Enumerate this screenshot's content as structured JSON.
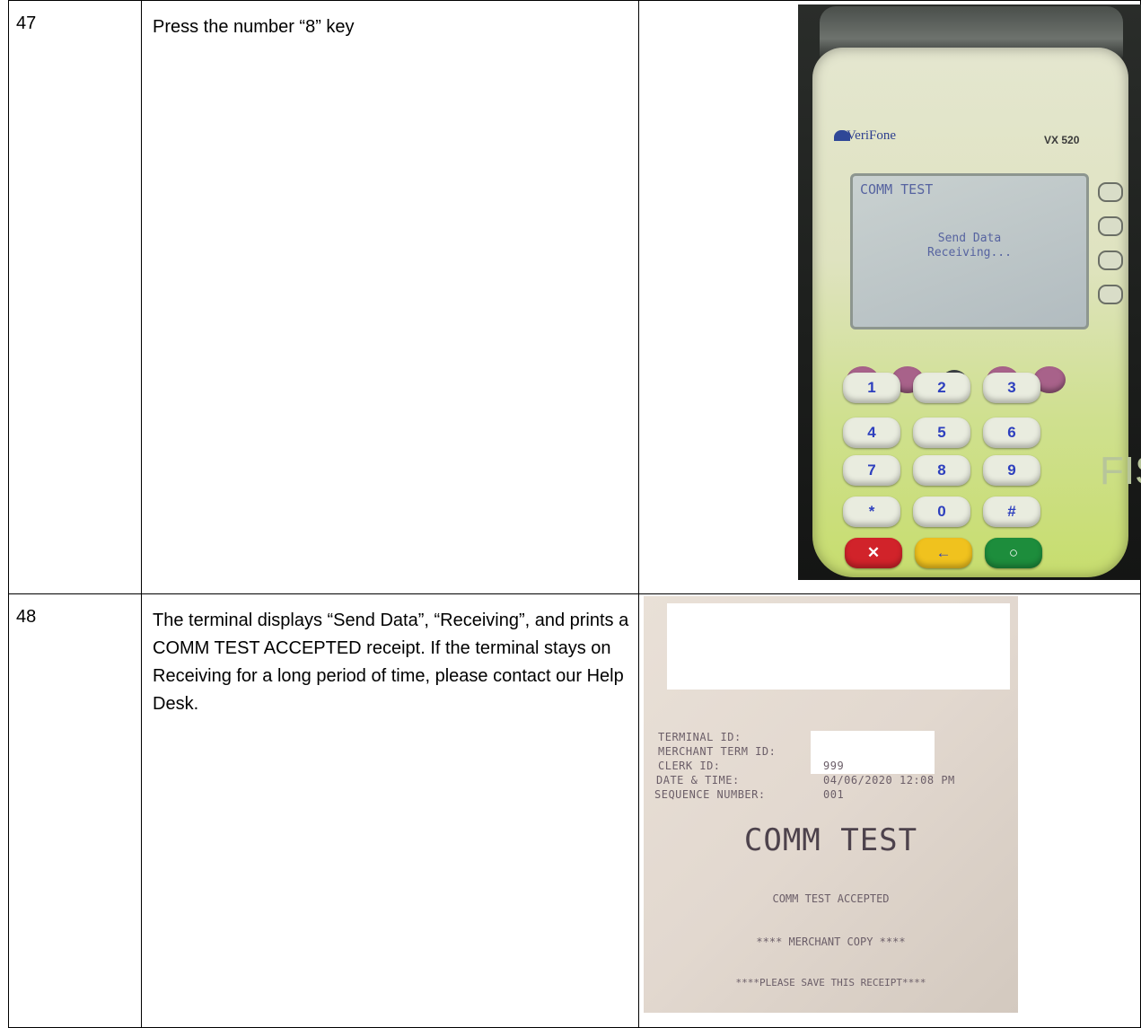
{
  "rows": [
    {
      "step": "47",
      "text": "Press the number “8” key"
    },
    {
      "step": "48",
      "text": "The terminal displays “Send Data”, “Receiving”, and prints a COMM TEST ACCEPTED receipt. If the terminal stays on Receiving for a long period of time, please contact our Help Desk."
    }
  ],
  "terminal": {
    "brand": "VeriFone",
    "model": "VX 520",
    "screen_title": "COMM TEST",
    "screen_line1": "Send Data",
    "screen_line2": "Receiving...",
    "keys": [
      "1",
      "2",
      "3",
      "4",
      "5",
      "6",
      "7",
      "8",
      "9",
      "*",
      "0",
      "#"
    ],
    "side_logo": "FIS"
  },
  "receipt": {
    "terminal_id_label": "TERMINAL ID:",
    "merchant_term_id_label": "MERCHANT TERM ID:",
    "clerk_id_label": "CLERK ID:",
    "clerk_id": "999",
    "date_time_label": "DATE & TIME:",
    "date_time": "04/06/2020 12:08 PM",
    "sequence_label": "SEQUENCE NUMBER:",
    "sequence": "001",
    "heading": "COMM TEST",
    "status": "COMM TEST ACCEPTED",
    "copy": "**** MERCHANT COPY ****",
    "save": "****PLEASE SAVE THIS RECEIPT****"
  }
}
